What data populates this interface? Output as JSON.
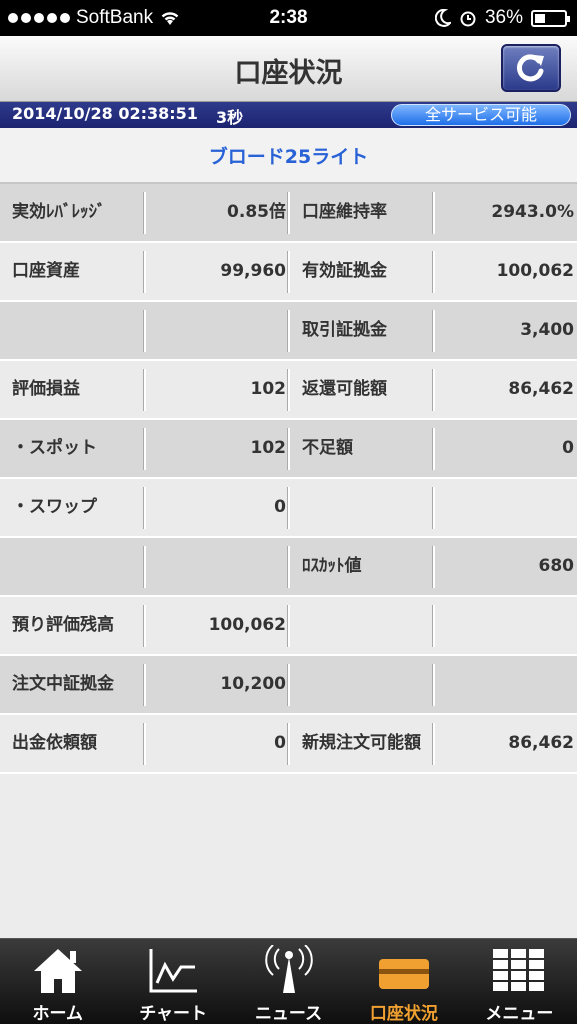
{
  "status_bar": {
    "carrier": "SoftBank",
    "time": "2:38",
    "battery": "36%",
    "battery_level": 0.36
  },
  "nav": {
    "title": "口座状況",
    "refresh_icon": "refresh-icon"
  },
  "info": {
    "datetime": "2014/10/28 02:38:51",
    "interval": "3秒",
    "service_status": "全サービス可能"
  },
  "plan": {
    "name": "ブロード25ライト"
  },
  "rows": [
    {
      "style": "dark",
      "l_label": "実効ﾚﾊﾞﾚｯｼﾞ",
      "l_value": "0.85倍",
      "r_label": "口座維持率",
      "r_value": "2943.0%"
    },
    {
      "style": "light",
      "l_label": "口座資産",
      "l_value": "99,960",
      "r_label": "有効証拠金",
      "r_value": "100,062"
    },
    {
      "style": "dark",
      "l_label": "",
      "l_value": "",
      "r_label": "取引証拠金",
      "r_value": "3,400"
    },
    {
      "style": "light",
      "l_label": "評価損益",
      "l_value": "102",
      "r_label": "返還可能額",
      "r_value": "86,462"
    },
    {
      "style": "dark",
      "l_label": "・スポット",
      "l_value": "102",
      "r_label": "不足額",
      "r_value": "0"
    },
    {
      "style": "light",
      "l_label": "・スワップ",
      "l_value": "0",
      "r_label": "",
      "r_value": ""
    },
    {
      "style": "dark",
      "l_label": "",
      "l_value": "",
      "r_label": "ﾛｽｶｯﾄ値",
      "r_value": "680"
    },
    {
      "style": "light",
      "l_label": "預り評価残高",
      "l_value": "100,062",
      "r_label": "",
      "r_value": ""
    },
    {
      "style": "dark",
      "l_label": "注文中証拠金",
      "l_value": "10,200",
      "r_label": "",
      "r_value": ""
    },
    {
      "style": "light",
      "l_label": "出金依頼額",
      "l_value": "0",
      "r_label": "新規注文可能額",
      "r_value": "86,462"
    }
  ],
  "tabs": [
    {
      "label": "ホーム",
      "icon": "home-icon",
      "active": false
    },
    {
      "label": "チャート",
      "icon": "chart-icon",
      "active": false
    },
    {
      "label": "ニュース",
      "icon": "broadcast-tower-icon",
      "active": false
    },
    {
      "label": "口座状況",
      "icon": "account-icon",
      "active": true
    },
    {
      "label": "メニュー",
      "icon": "grid-menu-icon",
      "active": false
    }
  ],
  "colors": {
    "accent_blue": "#2962d6",
    "header_navy": "#1c2470",
    "active_tab": "#f0a030"
  }
}
